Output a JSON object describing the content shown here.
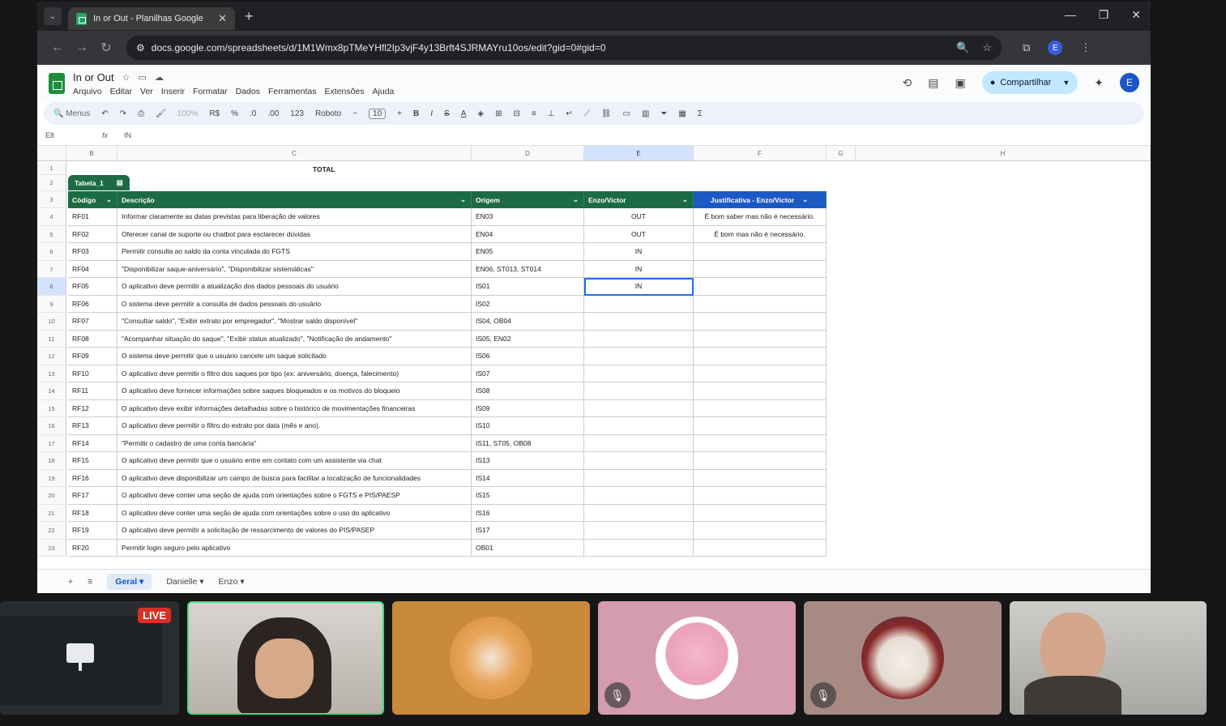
{
  "browser": {
    "tab_title": "In or Out - Planilhas Google",
    "url": "docs.google.com/spreadsheets/d/1M1Wmx8pTMeYHfl2Ip3vjF4y13Brft4SJRMAYru10os/edit?gid=0#gid=0"
  },
  "sheets": {
    "doc_title": "In or Out",
    "menu": [
      "Arquivo",
      "Editar",
      "Ver",
      "Inserir",
      "Formatar",
      "Dados",
      "Ferramentas",
      "Extensões",
      "Ajuda"
    ],
    "share_label": "Compartilhar",
    "account_initial": "E",
    "toolbar": {
      "search": "Menus",
      "zoom": "100%",
      "currency": "R$",
      "percent": "%",
      "number_format": "123",
      "font": "Roboto",
      "font_size": "10"
    },
    "name_box": "E8",
    "formula_value": "IN",
    "columns": [
      "B",
      "C",
      "D",
      "E",
      "F",
      "G",
      "H"
    ],
    "total_label": "TOTAL",
    "table_name": "Tabela_1",
    "headers": [
      "Código",
      "Descrição",
      "Origem",
      "Enzo/Victor",
      "Justificativa - Enzo/Victor"
    ],
    "rows": [
      {
        "n": "4",
        "code": "RF01",
        "desc": "Informar claramente as datas previstas para liberação de valores",
        "origin": "EN03",
        "status": "OUT",
        "just": "É bom saber mas não é necessário."
      },
      {
        "n": "5",
        "code": "RF02",
        "desc": "Oferecer canal de suporte ou chatbot para esclarecer dúvidas",
        "origin": "EN04",
        "status": "OUT",
        "just": "É bom mas não é necessário."
      },
      {
        "n": "6",
        "code": "RF03",
        "desc": "Permitir consulta ao saldo da conta vinculada do FGTS",
        "origin": "EN05",
        "status": "IN",
        "just": ""
      },
      {
        "n": "7",
        "code": "RF04",
        "desc": "\"Disponibilizar saque-aniversário\", \"Disponibilizar sistemáticas\"",
        "origin": "EN06, ST013, ST014",
        "status": "IN",
        "just": ""
      },
      {
        "n": "8",
        "code": "RF05",
        "desc": "O aplicativo deve permitir a atualização dos dados pessoais do usuário",
        "origin": "IS01",
        "status": "IN",
        "just": ""
      },
      {
        "n": "9",
        "code": "RF06",
        "desc": "O sistema deve permitir a consulta de dados pessoais do usuário",
        "origin": "IS02",
        "status": "",
        "just": ""
      },
      {
        "n": "10",
        "code": "RF07",
        "desc": "\"Consultar saldo\", \"Exibir extrato por empregador\", \"Mostrar saldo disponível\"",
        "origin": "IS04, OB04",
        "status": "",
        "just": ""
      },
      {
        "n": "11",
        "code": "RF08",
        "desc": "\"Acompanhar situação do saque\", \"Exibir status atualizado\", \"Notificação de andamento\"",
        "origin": "IS05, EN02",
        "status": "",
        "just": ""
      },
      {
        "n": "12",
        "code": "RF09",
        "desc": "O sistema deve permitir que o usuário cancele um saque solicitado",
        "origin": "IS06",
        "status": "",
        "just": ""
      },
      {
        "n": "13",
        "code": "RF10",
        "desc": "O aplicativo deve permitir o filtro dos saques por tipo (ex: aniversário, doença, falecimento)",
        "origin": "IS07",
        "status": "",
        "just": ""
      },
      {
        "n": "14",
        "code": "RF11",
        "desc": "O aplicativo deve fornecer informações sobre saques bloqueados e os motivos do bloqueio",
        "origin": "IS08",
        "status": "",
        "just": ""
      },
      {
        "n": "15",
        "code": "RF12",
        "desc": "O aplicativo deve exibir informações detalhadas sobre o histórico de movimentações financeiras",
        "origin": "IS09",
        "status": "",
        "just": ""
      },
      {
        "n": "16",
        "code": "RF13",
        "desc": "O aplicativo deve permitir o filtro do extrato por data (mês e ano).",
        "origin": "IS10",
        "status": "",
        "just": ""
      },
      {
        "n": "17",
        "code": "RF14",
        "desc": "\"Permitir o cadastro de uma conta bancária\"",
        "origin": "IS11, ST05, OB08",
        "status": "",
        "just": ""
      },
      {
        "n": "18",
        "code": "RF15",
        "desc": "O aplicativo deve permitir que o usuário entre em contato com um assistente via chat",
        "origin": "IS13",
        "status": "",
        "just": ""
      },
      {
        "n": "19",
        "code": "RF16",
        "desc": "O aplicativo deve disponibilizar um campo de busca para facilitar a localização de funcionalidades",
        "origin": "IS14",
        "status": "",
        "just": ""
      },
      {
        "n": "20",
        "code": "RF17",
        "desc": "O aplicativo deve conter uma seção de ajuda com orientações sobre o FGTS e PIS/PAESP",
        "origin": "IS15",
        "status": "",
        "just": ""
      },
      {
        "n": "21",
        "code": "RF18",
        "desc": "O aplicativo deve conter uma seção de ajuda com orientações sobre o uso do aplicativo",
        "origin": "IS16",
        "status": "",
        "just": ""
      },
      {
        "n": "22",
        "code": "RF19",
        "desc": "O aplicativo deve permitir a solicitação de ressarcimento de valores do PIS/PASEP",
        "origin": "IS17",
        "status": "",
        "just": ""
      },
      {
        "n": "23",
        "code": "RF20",
        "desc": "Permitir login seguro pelo aplicativo",
        "origin": "OB01",
        "status": "",
        "just": ""
      }
    ],
    "sheet_tabs": [
      "Geral",
      "Danielle",
      "Enzo"
    ]
  },
  "meet": {
    "live_label": "LIVE"
  },
  "colors": {
    "table_green": "#1d6b45",
    "header_blue": "#1c59c4",
    "share_bg": "#c2e7ff"
  }
}
